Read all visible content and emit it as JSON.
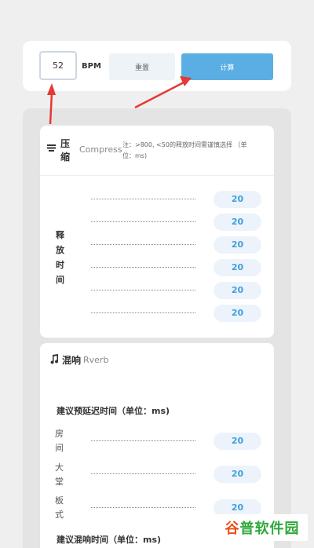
{
  "bpm": {
    "value": "52",
    "label": "BPM"
  },
  "buttons": {
    "reset": "重置",
    "calculate": "计算"
  },
  "compress": {
    "icon": "compress-icon",
    "title_cn_1": "压",
    "title_cn_2": "缩",
    "title_en": "Compress",
    "note_line1": "注：>800, <50的释放时间需谨慎选择 （单",
    "note_line2": "位：ms)",
    "release_label": [
      "释",
      "放",
      "时",
      "间"
    ],
    "release_values": [
      "20",
      "20",
      "20",
      "20",
      "20",
      "20"
    ]
  },
  "reverb": {
    "icon": "music-note-icon",
    "title_cn": "混响",
    "title_en": "Rverb",
    "predelay_heading": "建议预延迟时间（单位：ms)",
    "rooms": [
      {
        "chars": [
          "房",
          "间"
        ],
        "value": "20"
      },
      {
        "chars": [
          "大",
          "堂"
        ],
        "value": "20"
      },
      {
        "chars": [
          "板",
          "式"
        ],
        "value": "20"
      }
    ],
    "reverb_heading": "建议混响时间（单位：ms)"
  },
  "watermark": {
    "part1": "谷",
    "part2": "普软件园"
  },
  "colors": {
    "accent": "#5aaee3",
    "value_text": "#3d9fe0",
    "pill_bg": "#edf3fa",
    "arrow": "#e53935"
  }
}
